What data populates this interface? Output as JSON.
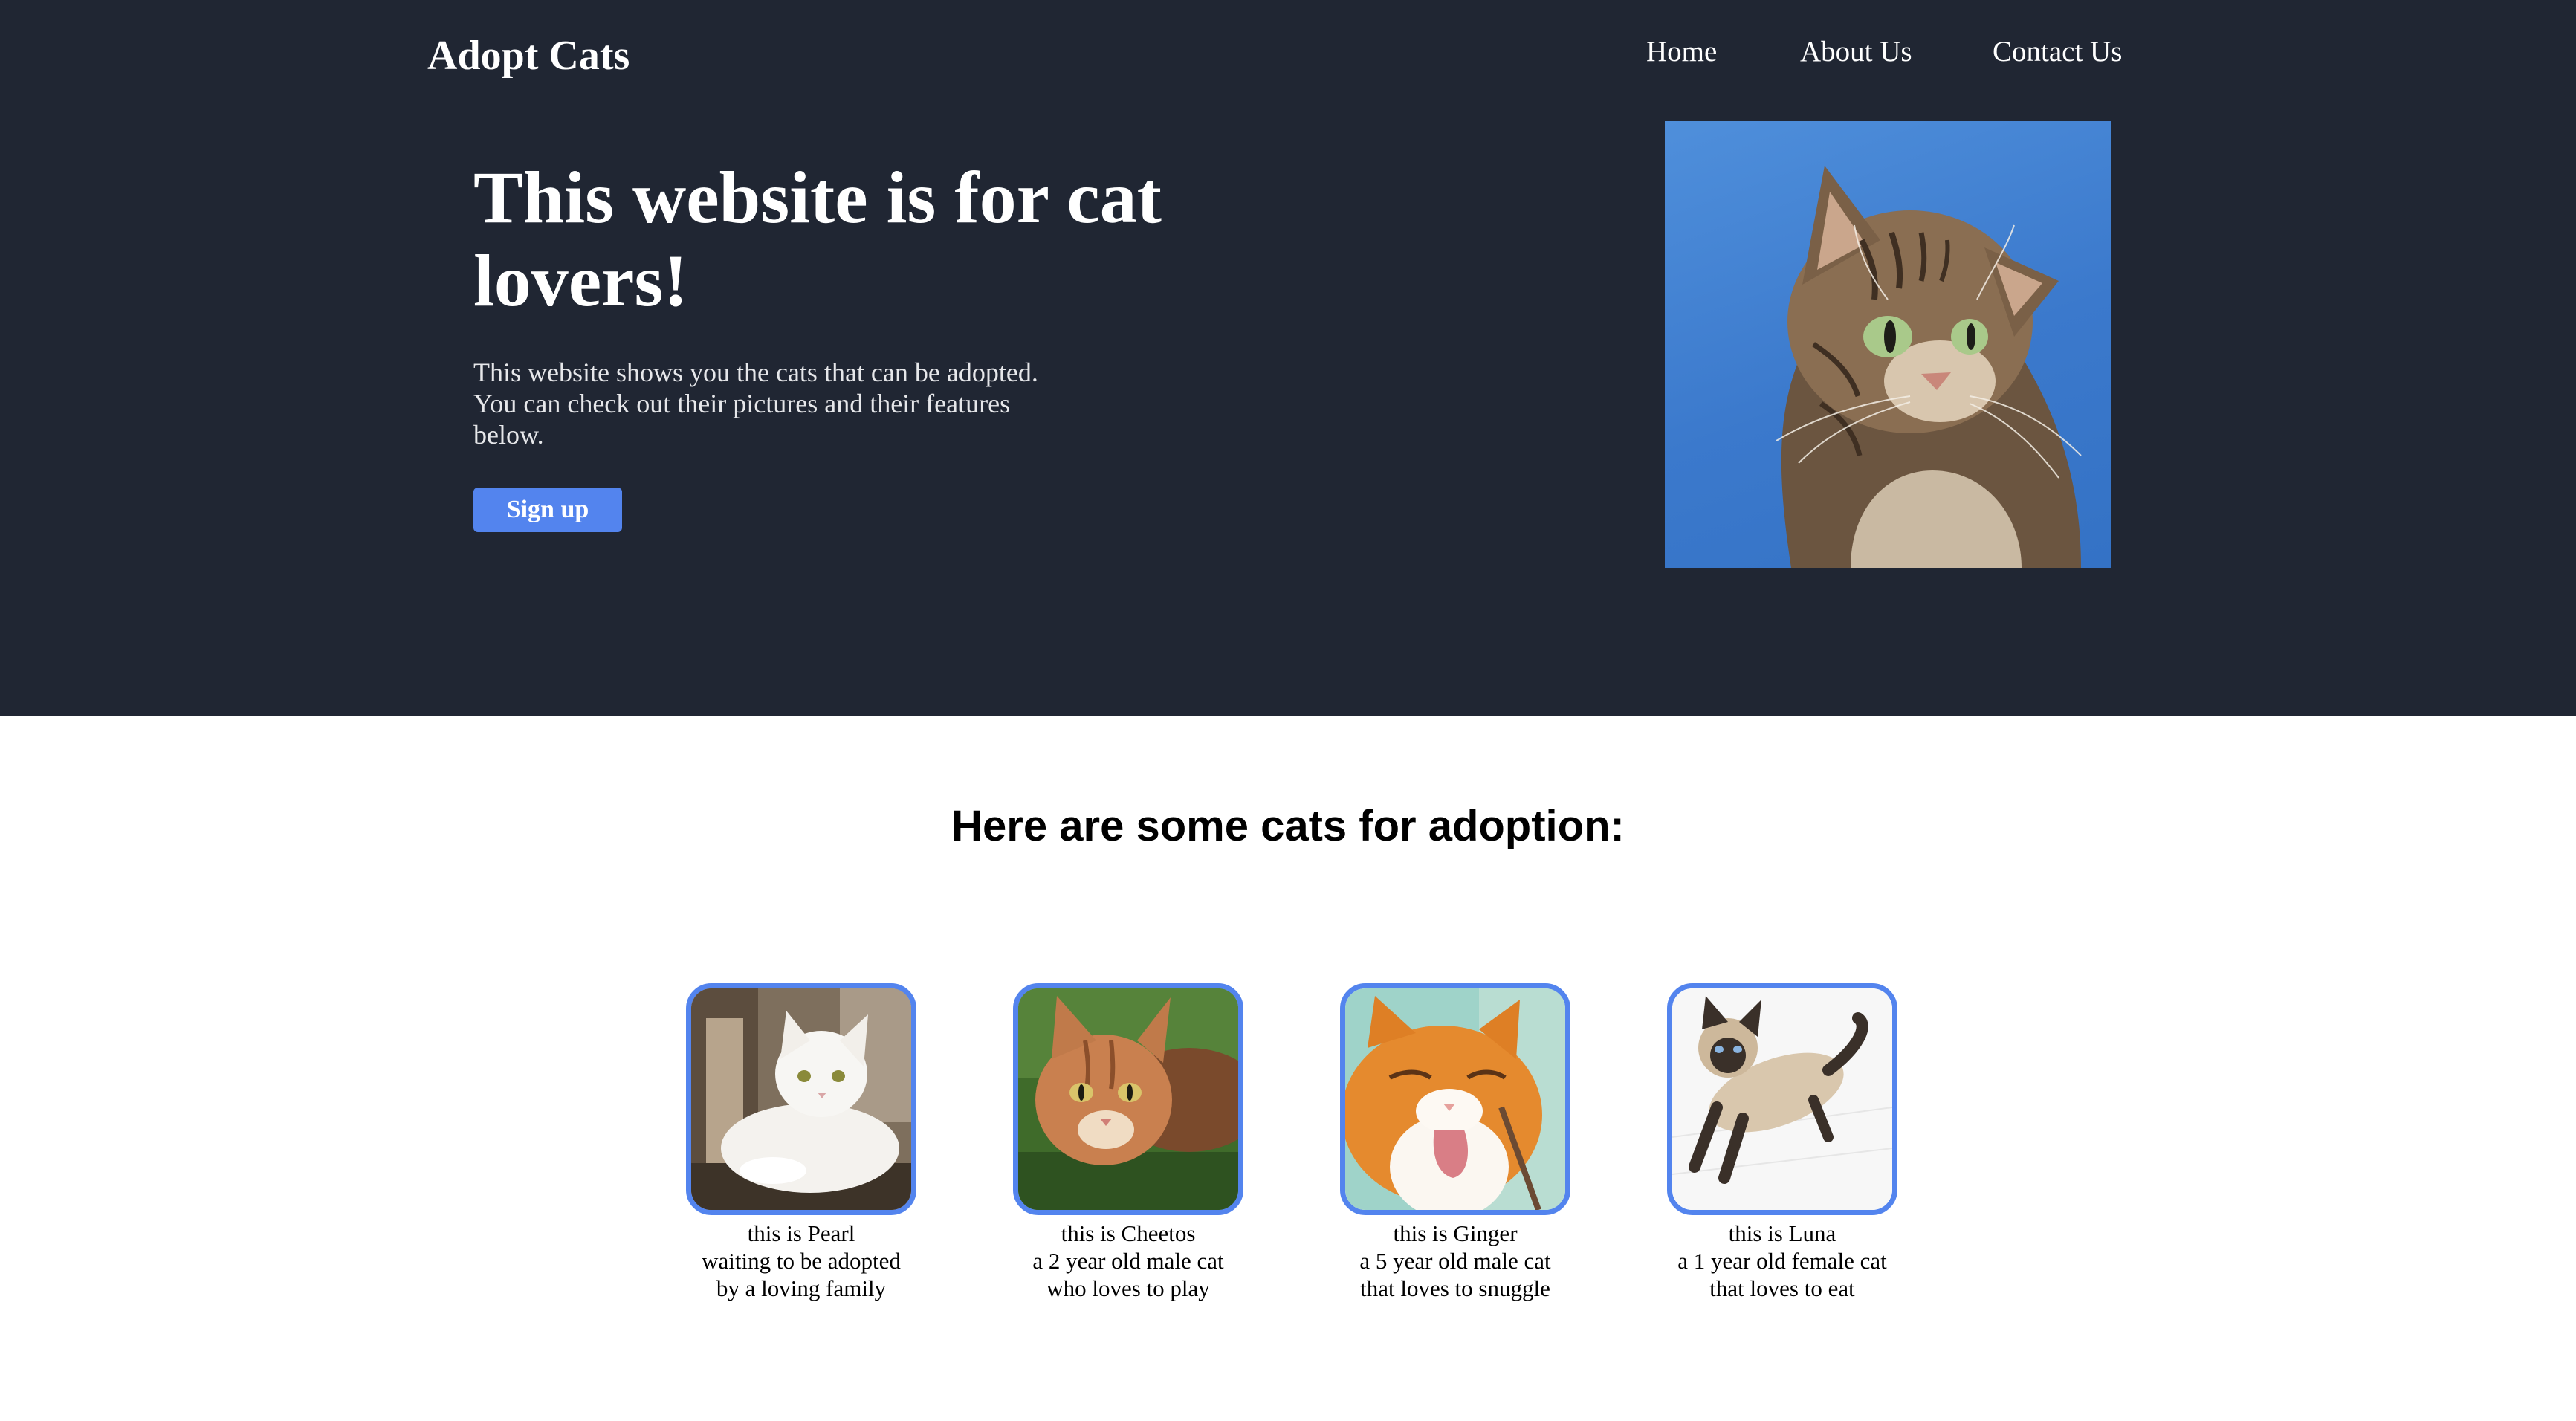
{
  "header": {
    "brand": "Adopt Cats",
    "nav": {
      "home": "Home",
      "about": "About Us",
      "contact": "Contact Us"
    }
  },
  "hero": {
    "title": "This website is for cat lovers!",
    "description": "This website shows you the cats that can be adopted. You can check out their pictures and their features below.",
    "signup_label": "Sign up"
  },
  "colors": {
    "hero_background": "#202633",
    "accent": "#5384ee",
    "page_background": "#ffffff"
  },
  "adoption": {
    "heading": "Here are some cats for adoption:",
    "cats": [
      {
        "name_line": "this is Pearl",
        "line2": "waiting to be adopted",
        "line3": "by a loving family"
      },
      {
        "name_line": "this is Cheetos",
        "line2": "a 2 year old male cat",
        "line3": "who loves to play"
      },
      {
        "name_line": "this is Ginger",
        "line2": "a 5 year old male cat",
        "line3": "that loves to snuggle"
      },
      {
        "name_line": "this is Luna",
        "line2": "a 1 year old female cat",
        "line3": "that loves to eat"
      }
    ]
  }
}
